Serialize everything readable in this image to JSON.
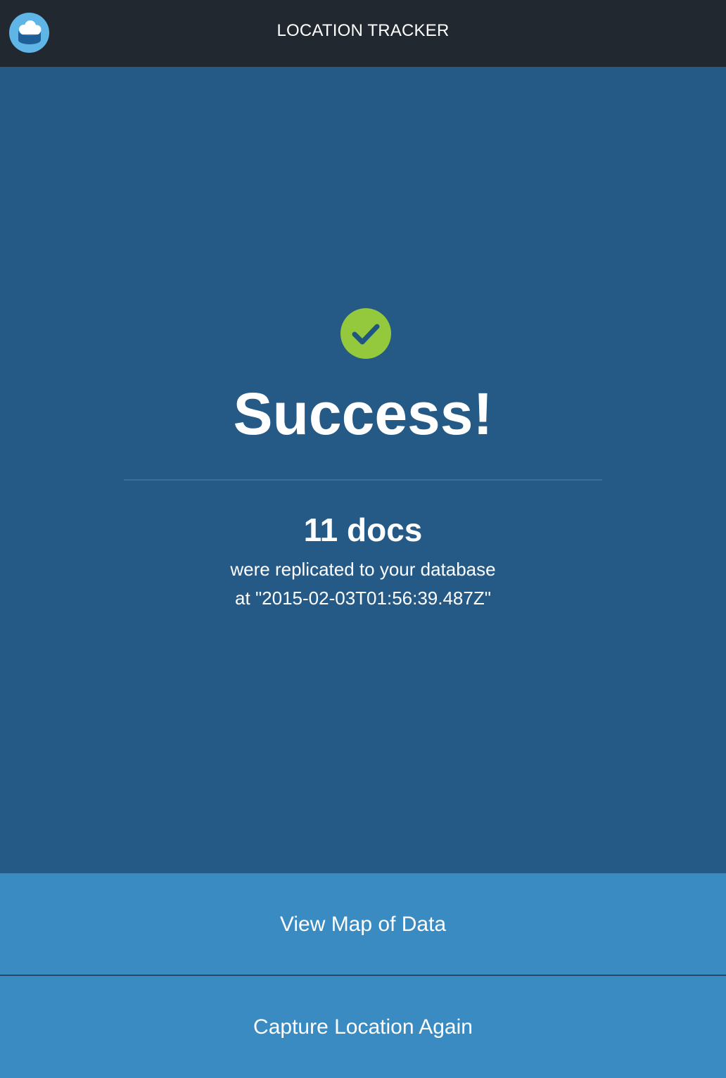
{
  "header": {
    "title": "LOCATION TRACKER",
    "logo_icon": "cloud-database-logo-icon"
  },
  "status": {
    "icon": "checkmark-circle-icon",
    "headline": "Success!",
    "count_text": "11 docs",
    "line1": "were replicated to your database",
    "line2": "at \"2015-02-03T01:56:39.487Z\""
  },
  "actions": {
    "view_map_label": "View Map of Data",
    "capture_again_label": "Capture Location Again"
  },
  "colors": {
    "header_bg": "#212830",
    "main_bg": "#255a87",
    "button_bg": "#3a8bc2",
    "success_green": "#95c93d"
  }
}
